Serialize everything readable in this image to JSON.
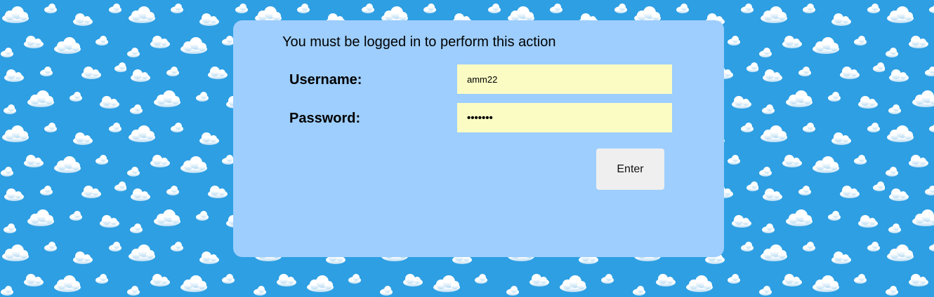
{
  "colors": {
    "sky": "#2e9fe3",
    "panel": "#9ecefd",
    "input": "#fafcc3",
    "button": "#efefef"
  },
  "background_icon": "cloud-pattern",
  "login": {
    "message": "You must be logged in to perform this action",
    "username_label": "Username:",
    "username_value": "amm22",
    "password_label": "Password:",
    "password_value": "•••••••",
    "enter_label": "Enter"
  }
}
